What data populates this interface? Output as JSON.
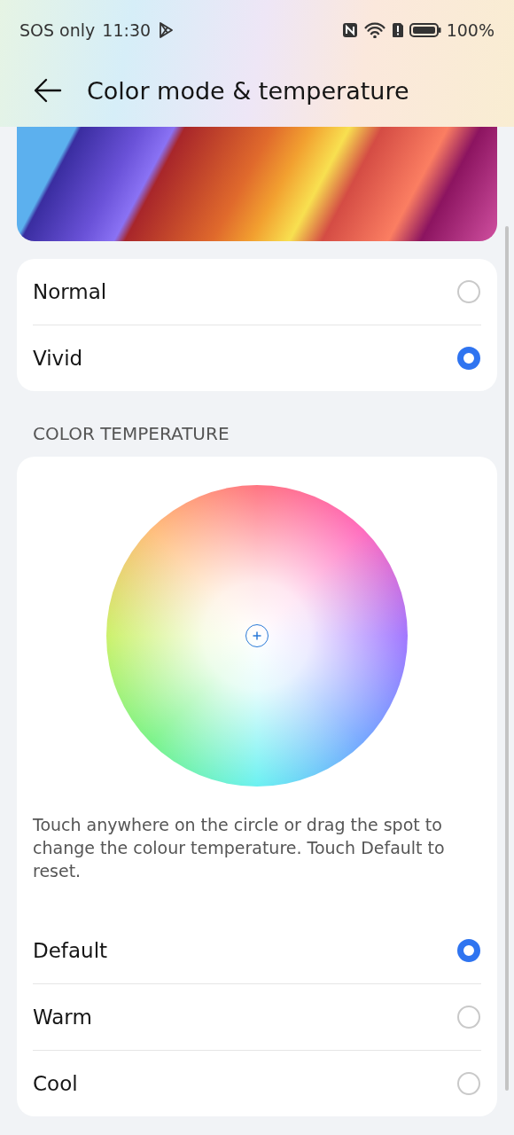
{
  "status_bar": {
    "carrier": "SOS only",
    "time": "11:30",
    "battery": "100%"
  },
  "header": {
    "title": "Color mode & temperature"
  },
  "color_modes": [
    {
      "label": "Normal",
      "selected": false
    },
    {
      "label": "Vivid",
      "selected": true
    }
  ],
  "color_temperature": {
    "section_title": "COLOR TEMPERATURE",
    "hint": "Touch anywhere on the circle or drag the spot to change the colour temperature. Touch Default to reset.",
    "options": [
      {
        "label": "Default",
        "selected": true
      },
      {
        "label": "Warm",
        "selected": false
      },
      {
        "label": "Cool",
        "selected": false
      }
    ]
  }
}
